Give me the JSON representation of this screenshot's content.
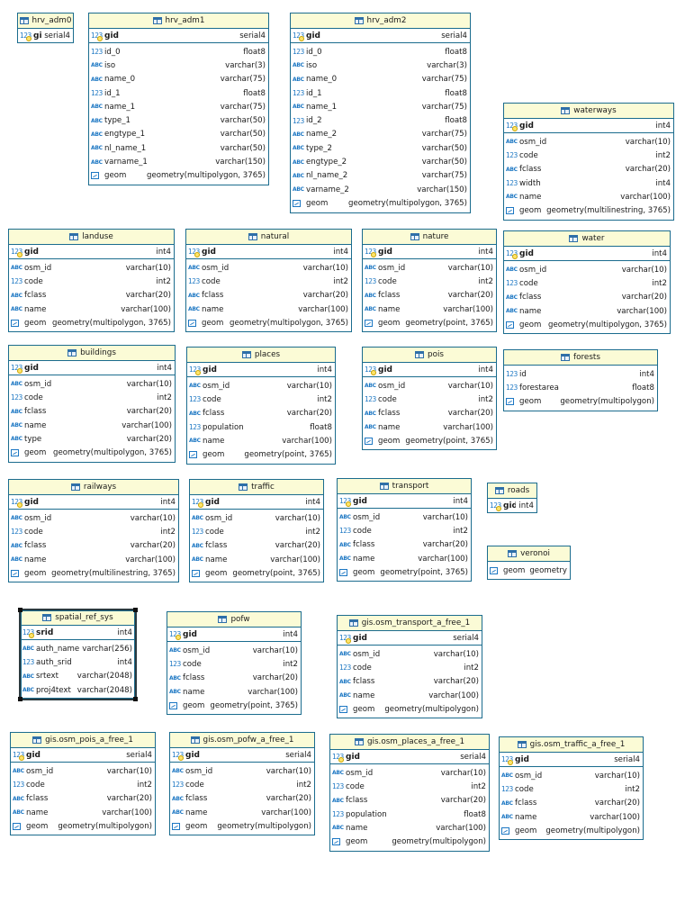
{
  "tables": [
    {
      "id": "hrv_adm0",
      "title": "hrv_adm0",
      "pk": {
        "name": "gid",
        "type": "serial4"
      },
      "columns": []
    },
    {
      "id": "hrv_adm1",
      "title": "hrv_adm1",
      "pk": {
        "name": "gid",
        "type": "serial4"
      },
      "columns": [
        {
          "name": "id_0",
          "type": "float8",
          "icon": "num"
        },
        {
          "name": "iso",
          "type": "varchar(3)",
          "icon": "text"
        },
        {
          "name": "name_0",
          "type": "varchar(75)",
          "icon": "text"
        },
        {
          "name": "id_1",
          "type": "float8",
          "icon": "num"
        },
        {
          "name": "name_1",
          "type": "varchar(75)",
          "icon": "text"
        },
        {
          "name": "type_1",
          "type": "varchar(50)",
          "icon": "text"
        },
        {
          "name": "engtype_1",
          "type": "varchar(50)",
          "icon": "text"
        },
        {
          "name": "nl_name_1",
          "type": "varchar(50)",
          "icon": "text"
        },
        {
          "name": "varname_1",
          "type": "varchar(150)",
          "icon": "text"
        },
        {
          "name": "geom",
          "type": "geometry(multipolygon, 3765)",
          "icon": "geo"
        }
      ]
    },
    {
      "id": "hrv_adm2",
      "title": "hrv_adm2",
      "pk": {
        "name": "gid",
        "type": "serial4"
      },
      "columns": [
        {
          "name": "id_0",
          "type": "float8",
          "icon": "num"
        },
        {
          "name": "iso",
          "type": "varchar(3)",
          "icon": "text"
        },
        {
          "name": "name_0",
          "type": "varchar(75)",
          "icon": "text"
        },
        {
          "name": "id_1",
          "type": "float8",
          "icon": "num"
        },
        {
          "name": "name_1",
          "type": "varchar(75)",
          "icon": "text"
        },
        {
          "name": "id_2",
          "type": "float8",
          "icon": "num"
        },
        {
          "name": "name_2",
          "type": "varchar(75)",
          "icon": "text"
        },
        {
          "name": "type_2",
          "type": "varchar(50)",
          "icon": "text"
        },
        {
          "name": "engtype_2",
          "type": "varchar(50)",
          "icon": "text"
        },
        {
          "name": "nl_name_2",
          "type": "varchar(75)",
          "icon": "text"
        },
        {
          "name": "varname_2",
          "type": "varchar(150)",
          "icon": "text"
        },
        {
          "name": "geom",
          "type": "geometry(multipolygon, 3765)",
          "icon": "geo"
        }
      ]
    },
    {
      "id": "waterways",
      "title": "waterways",
      "pk": {
        "name": "gid",
        "type": "int4"
      },
      "columns": [
        {
          "name": "osm_id",
          "type": "varchar(10)",
          "icon": "text"
        },
        {
          "name": "code",
          "type": "int2",
          "icon": "num"
        },
        {
          "name": "fclass",
          "type": "varchar(20)",
          "icon": "text"
        },
        {
          "name": "width",
          "type": "int4",
          "icon": "num"
        },
        {
          "name": "name",
          "type": "varchar(100)",
          "icon": "text"
        },
        {
          "name": "geom",
          "type": "geometry(multilinestring, 3765)",
          "icon": "geo"
        }
      ]
    },
    {
      "id": "landuse",
      "title": "landuse",
      "pk": {
        "name": "gid",
        "type": "int4"
      },
      "columns": [
        {
          "name": "osm_id",
          "type": "varchar(10)",
          "icon": "text"
        },
        {
          "name": "code",
          "type": "int2",
          "icon": "num"
        },
        {
          "name": "fclass",
          "type": "varchar(20)",
          "icon": "text"
        },
        {
          "name": "name",
          "type": "varchar(100)",
          "icon": "text"
        },
        {
          "name": "geom",
          "type": "geometry(multipolygon, 3765)",
          "icon": "geo"
        }
      ]
    },
    {
      "id": "natural",
      "title": "natural",
      "pk": {
        "name": "gid",
        "type": "int4"
      },
      "columns": [
        {
          "name": "osm_id",
          "type": "varchar(10)",
          "icon": "text"
        },
        {
          "name": "code",
          "type": "int2",
          "icon": "num"
        },
        {
          "name": "fclass",
          "type": "varchar(20)",
          "icon": "text"
        },
        {
          "name": "name",
          "type": "varchar(100)",
          "icon": "text"
        },
        {
          "name": "geom",
          "type": "geometry(multipolygon, 3765)",
          "icon": "geo"
        }
      ]
    },
    {
      "id": "nature",
      "title": "nature",
      "pk": {
        "name": "gid",
        "type": "int4"
      },
      "columns": [
        {
          "name": "osm_id",
          "type": "varchar(10)",
          "icon": "text"
        },
        {
          "name": "code",
          "type": "int2",
          "icon": "num"
        },
        {
          "name": "fclass",
          "type": "varchar(20)",
          "icon": "text"
        },
        {
          "name": "name",
          "type": "varchar(100)",
          "icon": "text"
        },
        {
          "name": "geom",
          "type": "geometry(point, 3765)",
          "icon": "geo"
        }
      ]
    },
    {
      "id": "water",
      "title": "water",
      "pk": {
        "name": "gid",
        "type": "int4"
      },
      "columns": [
        {
          "name": "osm_id",
          "type": "varchar(10)",
          "icon": "text"
        },
        {
          "name": "code",
          "type": "int2",
          "icon": "num"
        },
        {
          "name": "fclass",
          "type": "varchar(20)",
          "icon": "text"
        },
        {
          "name": "name",
          "type": "varchar(100)",
          "icon": "text"
        },
        {
          "name": "geom",
          "type": "geometry(multipolygon, 3765)",
          "icon": "geo"
        }
      ]
    },
    {
      "id": "buildings",
      "title": "buildings",
      "pk": {
        "name": "gid",
        "type": "int4"
      },
      "columns": [
        {
          "name": "osm_id",
          "type": "varchar(10)",
          "icon": "text"
        },
        {
          "name": "code",
          "type": "int2",
          "icon": "num"
        },
        {
          "name": "fclass",
          "type": "varchar(20)",
          "icon": "text"
        },
        {
          "name": "name",
          "type": "varchar(100)",
          "icon": "text"
        },
        {
          "name": "type",
          "type": "varchar(20)",
          "icon": "text"
        },
        {
          "name": "geom",
          "type": "geometry(multipolygon, 3765)",
          "icon": "geo"
        }
      ]
    },
    {
      "id": "places",
      "title": "places",
      "pk": {
        "name": "gid",
        "type": "int4"
      },
      "columns": [
        {
          "name": "osm_id",
          "type": "varchar(10)",
          "icon": "text"
        },
        {
          "name": "code",
          "type": "int2",
          "icon": "num"
        },
        {
          "name": "fclass",
          "type": "varchar(20)",
          "icon": "text"
        },
        {
          "name": "population",
          "type": "float8",
          "icon": "num"
        },
        {
          "name": "name",
          "type": "varchar(100)",
          "icon": "text"
        },
        {
          "name": "geom",
          "type": "geometry(point, 3765)",
          "icon": "geo"
        }
      ]
    },
    {
      "id": "pois",
      "title": "pois",
      "pk": {
        "name": "gid",
        "type": "int4"
      },
      "columns": [
        {
          "name": "osm_id",
          "type": "varchar(10)",
          "icon": "text"
        },
        {
          "name": "code",
          "type": "int2",
          "icon": "num"
        },
        {
          "name": "fclass",
          "type": "varchar(20)",
          "icon": "text"
        },
        {
          "name": "name",
          "type": "varchar(100)",
          "icon": "text"
        },
        {
          "name": "geom",
          "type": "geometry(point, 3765)",
          "icon": "geo"
        }
      ]
    },
    {
      "id": "forests",
      "title": "forests",
      "pk": null,
      "columns": [
        {
          "name": "id",
          "type": "int4",
          "icon": "num"
        },
        {
          "name": "forestarea",
          "type": "float8",
          "icon": "num"
        },
        {
          "name": "geom",
          "type": "geometry(multipolygon)",
          "icon": "geo"
        }
      ]
    },
    {
      "id": "railways",
      "title": "railways",
      "pk": {
        "name": "gid",
        "type": "int4"
      },
      "columns": [
        {
          "name": "osm_id",
          "type": "varchar(10)",
          "icon": "text"
        },
        {
          "name": "code",
          "type": "int2",
          "icon": "num"
        },
        {
          "name": "fclass",
          "type": "varchar(20)",
          "icon": "text"
        },
        {
          "name": "name",
          "type": "varchar(100)",
          "icon": "text"
        },
        {
          "name": "geom",
          "type": "geometry(multilinestring, 3765)",
          "icon": "geo"
        }
      ]
    },
    {
      "id": "traffic",
      "title": "traffic",
      "pk": {
        "name": "gid",
        "type": "int4"
      },
      "columns": [
        {
          "name": "osm_id",
          "type": "varchar(10)",
          "icon": "text"
        },
        {
          "name": "code",
          "type": "int2",
          "icon": "num"
        },
        {
          "name": "fclass",
          "type": "varchar(20)",
          "icon": "text"
        },
        {
          "name": "name",
          "type": "varchar(100)",
          "icon": "text"
        },
        {
          "name": "geom",
          "type": "geometry(point, 3765)",
          "icon": "geo"
        }
      ]
    },
    {
      "id": "transport",
      "title": "transport",
      "pk": {
        "name": "gid",
        "type": "int4"
      },
      "columns": [
        {
          "name": "osm_id",
          "type": "varchar(10)",
          "icon": "text"
        },
        {
          "name": "code",
          "type": "int2",
          "icon": "num"
        },
        {
          "name": "fclass",
          "type": "varchar(20)",
          "icon": "text"
        },
        {
          "name": "name",
          "type": "varchar(100)",
          "icon": "text"
        },
        {
          "name": "geom",
          "type": "geometry(point, 3765)",
          "icon": "geo"
        }
      ]
    },
    {
      "id": "roads",
      "title": "roads",
      "pk": {
        "name": "gid",
        "type": "int4"
      },
      "columns": []
    },
    {
      "id": "veronoi",
      "title": "veronoi",
      "pk": null,
      "columns": [
        {
          "name": "geom",
          "type": "geometry",
          "icon": "geo"
        }
      ]
    },
    {
      "id": "spatial_ref_sys",
      "title": "spatial_ref_sys",
      "pk": {
        "name": "srid",
        "type": "int4"
      },
      "columns": [
        {
          "name": "auth_name",
          "type": "varchar(256)",
          "icon": "text"
        },
        {
          "name": "auth_srid",
          "type": "int4",
          "icon": "num"
        },
        {
          "name": "srtext",
          "type": "varchar(2048)",
          "icon": "text"
        },
        {
          "name": "proj4text",
          "type": "varchar(2048)",
          "icon": "text"
        }
      ]
    },
    {
      "id": "pofw",
      "title": "pofw",
      "pk": {
        "name": "gid",
        "type": "int4"
      },
      "columns": [
        {
          "name": "osm_id",
          "type": "varchar(10)",
          "icon": "text"
        },
        {
          "name": "code",
          "type": "int2",
          "icon": "num"
        },
        {
          "name": "fclass",
          "type": "varchar(20)",
          "icon": "text"
        },
        {
          "name": "name",
          "type": "varchar(100)",
          "icon": "text"
        },
        {
          "name": "geom",
          "type": "geometry(point, 3765)",
          "icon": "geo"
        }
      ]
    },
    {
      "id": "gis_osm_transport_a_free_1",
      "title": "gis.osm_transport_a_free_1",
      "pk": {
        "name": "gid",
        "type": "serial4"
      },
      "columns": [
        {
          "name": "osm_id",
          "type": "varchar(10)",
          "icon": "text"
        },
        {
          "name": "code",
          "type": "int2",
          "icon": "num"
        },
        {
          "name": "fclass",
          "type": "varchar(20)",
          "icon": "text"
        },
        {
          "name": "name",
          "type": "varchar(100)",
          "icon": "text"
        },
        {
          "name": "geom",
          "type": "geometry(multipolygon)",
          "icon": "geo"
        }
      ]
    },
    {
      "id": "gis_osm_pois_a_free_1",
      "title": "gis.osm_pois_a_free_1",
      "pk": {
        "name": "gid",
        "type": "serial4"
      },
      "columns": [
        {
          "name": "osm_id",
          "type": "varchar(10)",
          "icon": "text"
        },
        {
          "name": "code",
          "type": "int2",
          "icon": "num"
        },
        {
          "name": "fclass",
          "type": "varchar(20)",
          "icon": "text"
        },
        {
          "name": "name",
          "type": "varchar(100)",
          "icon": "text"
        },
        {
          "name": "geom",
          "type": "geometry(multipolygon)",
          "icon": "geo"
        }
      ]
    },
    {
      "id": "gis_osm_pofw_a_free_1",
      "title": "gis.osm_pofw_a_free_1",
      "pk": {
        "name": "gid",
        "type": "serial4"
      },
      "columns": [
        {
          "name": "osm_id",
          "type": "varchar(10)",
          "icon": "text"
        },
        {
          "name": "code",
          "type": "int2",
          "icon": "num"
        },
        {
          "name": "fclass",
          "type": "varchar(20)",
          "icon": "text"
        },
        {
          "name": "name",
          "type": "varchar(100)",
          "icon": "text"
        },
        {
          "name": "geom",
          "type": "geometry(multipolygon)",
          "icon": "geo"
        }
      ]
    },
    {
      "id": "gis_osm_places_a_free_1",
      "title": "gis.osm_places_a_free_1",
      "pk": {
        "name": "gid",
        "type": "serial4"
      },
      "columns": [
        {
          "name": "osm_id",
          "type": "varchar(10)",
          "icon": "text"
        },
        {
          "name": "code",
          "type": "int2",
          "icon": "num"
        },
        {
          "name": "fclass",
          "type": "varchar(20)",
          "icon": "text"
        },
        {
          "name": "population",
          "type": "float8",
          "icon": "num"
        },
        {
          "name": "name",
          "type": "varchar(100)",
          "icon": "text"
        },
        {
          "name": "geom",
          "type": "geometry(multipolygon)",
          "icon": "geo"
        }
      ]
    },
    {
      "id": "gis_osm_traffic_a_free_1",
      "title": "gis.osm_traffic_a_free_1",
      "pk": {
        "name": "gid",
        "type": "serial4"
      },
      "columns": [
        {
          "name": "osm_id",
          "type": "varchar(10)",
          "icon": "text"
        },
        {
          "name": "code",
          "type": "int2",
          "icon": "num"
        },
        {
          "name": "fclass",
          "type": "varchar(20)",
          "icon": "text"
        },
        {
          "name": "name",
          "type": "varchar(100)",
          "icon": "text"
        },
        {
          "name": "geom",
          "type": "geometry(multipolygon)",
          "icon": "geo"
        }
      ]
    }
  ],
  "selected_table": "spatial_ref_sys",
  "icons": {
    "table": "table-icon",
    "text_column": "text-type-icon",
    "numeric_column": "numeric-type-icon",
    "geometry_column": "geometry-type-icon",
    "primary_key": "key-icon"
  },
  "colors": {
    "border": "#1b6c8e",
    "header_bg": "#fbfbd6",
    "icon_blue": "#1c77c3",
    "key_gold": "#ffe46b"
  }
}
